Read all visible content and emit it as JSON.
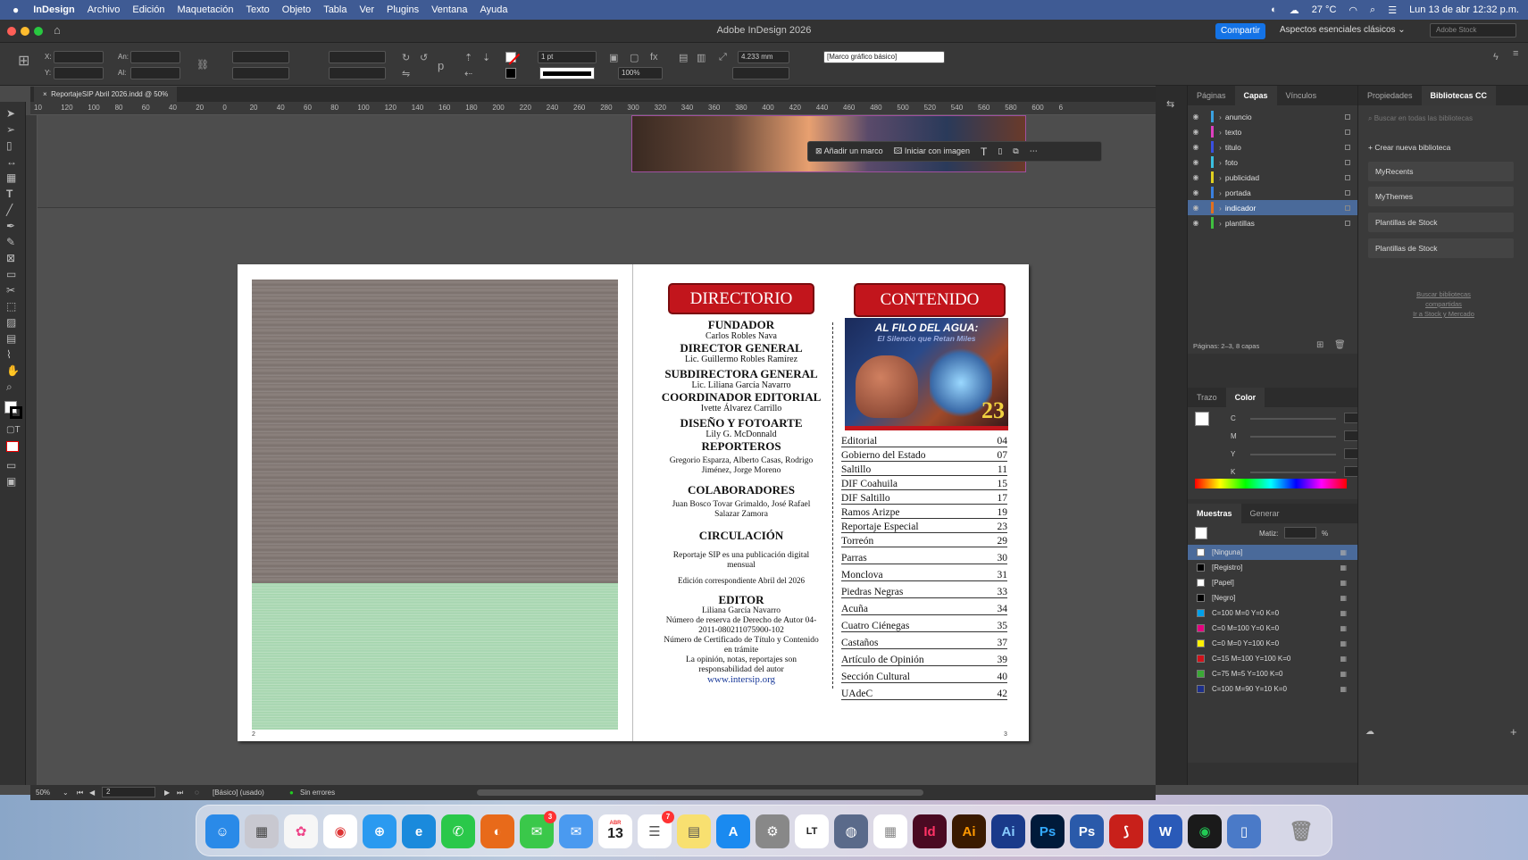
{
  "menubar": {
    "apple": "",
    "app_name": "InDesign",
    "items": [
      "Archivo",
      "Edición",
      "Maquetación",
      "Texto",
      "Objeto",
      "Tabla",
      "Ver",
      "Plugins",
      "Ventana",
      "Ayuda"
    ],
    "temperature": "27 °C",
    "datetime": "Lun 13 de abr  12:32 p.m."
  },
  "window": {
    "title": "Adobe InDesign 2026",
    "share_label": "Compartir",
    "workspace_label": "Aspectos esenciales clásicos",
    "stock_placeholder": "Adobe Stock"
  },
  "control": {
    "x_label": "X:",
    "y_label": "Y:",
    "w_label": "An:",
    "h_label": "Al:",
    "stroke_weight": "1 pt",
    "offset_value": "4.233 mm",
    "scale_value": "100%",
    "frame_style": "[Marco gráfico básico]"
  },
  "document": {
    "tab_title": "ReportajeSIP Abril 2026.indd @ 50%",
    "ruler_ticks": [
      "10",
      "120",
      "100",
      "80",
      "60",
      "40",
      "20",
      "0",
      "20",
      "40",
      "60",
      "80",
      "100",
      "120",
      "140",
      "160",
      "180",
      "200",
      "220",
      "240",
      "260",
      "280",
      "300",
      "320",
      "340",
      "360",
      "380",
      "400",
      "420",
      "440",
      "460",
      "480",
      "500",
      "520",
      "540",
      "560",
      "580",
      "600",
      "6"
    ]
  },
  "context_bar": {
    "add_frame": "Añadir un marco",
    "start_image": "Iniciar con imagen"
  },
  "page_left": {
    "page_number": "2"
  },
  "page_right": {
    "page_number": "3"
  },
  "directorio": {
    "heading": "DIRECTORIO",
    "founder_title": "FUNDADOR",
    "founder_name": "Carlos Robles Nava",
    "director_title": "DIRECTOR GENERAL",
    "director_name": "Lic. Guillermo Robles Ramírez",
    "sub_title": "SUBDIRECTORA GENERAL",
    "sub_name": "Lic. Liliana García Navarro",
    "coord_title": "COORDINADOR EDITORIAL",
    "coord_name": "Ivette Álvarez Carrillo",
    "design_title": "DISEÑO Y FOTOARTE",
    "design_name": "Lily G. McDonnald",
    "reporters_title": "REPORTEROS",
    "reporters_names": "Gregorio Esparza, Alberto Casas, Rodrigo Jiménez, Jorge Moreno",
    "collab_title": "COLABORADORES",
    "collab_names": "Juan Bosco Tovar Grimaldo, José Rafael Salazar Zamora",
    "circ_title": "CIRCULACIÓN",
    "circ_text": "Reportaje SIP es una publicación digital mensual",
    "edition_text": "Edición correspondiente Abril del 2026",
    "editor_title": "EDITOR",
    "editor_name": "Liliana García Navarro",
    "reserve_text": "Número de reserva de Derecho de Autor 04-2011-080211075900-102",
    "cert_text": "Número de Certificado de Título y Contenido en trámite",
    "opinion_text": "La opinión, notas, reportajes son responsabilidad del autor",
    "website": "www.intersip.org"
  },
  "contenido": {
    "heading": "CONTENIDO",
    "cover_title": "AL FILO DEL AGUA:",
    "cover_subtitle": "El Silencio que Retan Miles",
    "cover_number": "23",
    "toc": [
      {
        "title": "Editorial",
        "page": "04"
      },
      {
        "title": "Gobierno del Estado",
        "page": "07"
      },
      {
        "title": "Saltillo",
        "page": "11"
      },
      {
        "title": "DIF Coahuila",
        "page": "15"
      },
      {
        "title": "DIF Saltillo",
        "page": "17"
      },
      {
        "title": "Ramos Arizpe",
        "page": "19"
      },
      {
        "title": "Reportaje Especial",
        "page": "23"
      },
      {
        "title": "Torreón",
        "page": "29"
      },
      {
        "title": "Parras",
        "page": "30"
      },
      {
        "title": "Monclova",
        "page": "31"
      },
      {
        "title": "Piedras Negras",
        "page": "33"
      },
      {
        "title": "Acuña",
        "page": "34"
      },
      {
        "title": "Cuatro Ciénegas",
        "page": "35"
      },
      {
        "title": "Castaños",
        "page": "37"
      },
      {
        "title": "Artículo de Opinión",
        "page": "39"
      },
      {
        "title": "Sección Cultural",
        "page": "40"
      },
      {
        "title": "UAdeC",
        "page": "42"
      }
    ]
  },
  "layers_panel": {
    "tabs": [
      "Páginas",
      "Capas",
      "Vínculos"
    ],
    "active_tab": "Capas",
    "layers": [
      {
        "name": "anuncio",
        "color": "#3aa0e0"
      },
      {
        "name": "texto",
        "color": "#e040c0"
      },
      {
        "name": "titulo",
        "color": "#3a50e0"
      },
      {
        "name": "foto",
        "color": "#3ac0e0"
      },
      {
        "name": "publicidad",
        "color": "#e0d020"
      },
      {
        "name": "portada",
        "color": "#3a80e0"
      },
      {
        "name": "indicador",
        "color": "#e07020"
      },
      {
        "name": "plantillas",
        "color": "#40c040"
      }
    ],
    "selected_layer": "indicador",
    "footer": "Páginas: 2–3, 8 capas"
  },
  "color_panel": {
    "tabs": [
      "Trazo",
      "Color"
    ],
    "channels": [
      "C",
      "M",
      "Y",
      "K"
    ],
    "percent": "%"
  },
  "swatches_panel": {
    "tabs": [
      "Muestras",
      "Generar"
    ],
    "tint_label": "Matiz:",
    "percent": "%",
    "swatches": [
      {
        "name": "[Ninguna]",
        "color": "#ffffff"
      },
      {
        "name": "[Registro]",
        "color": "#000000"
      },
      {
        "name": "[Papel]",
        "color": "#ffffff"
      },
      {
        "name": "[Negro]",
        "color": "#000000"
      },
      {
        "name": "C=100 M=0 Y=0 K=0",
        "color": "#00a0e9"
      },
      {
        "name": "C=0 M=100 Y=0 K=0",
        "color": "#e4007f"
      },
      {
        "name": "C=0 M=0 Y=100 K=0",
        "color": "#fff100"
      },
      {
        "name": "C=15 M=100 Y=100 K=0",
        "color": "#d0121b"
      },
      {
        "name": "C=75 M=5 Y=100 K=0",
        "color": "#3aa935"
      },
      {
        "name": "C=100 M=90 Y=10 K=0",
        "color": "#1d2f8a"
      }
    ],
    "selected_swatch": "[Ninguna]"
  },
  "cc_panel": {
    "tabs": [
      "Propiedades",
      "Bibliotecas CC"
    ],
    "active_tab": "Bibliotecas CC",
    "search_placeholder": "Buscar en todas las bibliotecas",
    "create_label": "Crear nueva biblioteca",
    "libraries": [
      "MyRecents",
      "MyThemes",
      "Plantillas de Stock",
      "Plantillas de Stock"
    ],
    "link1": "Buscar bibliotecas",
    "link2": "compartidas",
    "link3": "Ir a Stock y Mercado"
  },
  "statusbar": {
    "zoom": "50%",
    "page": "2",
    "style": "[Básico] (usado)",
    "preflight": "Sin errores"
  },
  "dock": {
    "calendar_day": "13",
    "calendar_month": "ABR",
    "messages_badge": "3",
    "reminders_badge": "7"
  }
}
